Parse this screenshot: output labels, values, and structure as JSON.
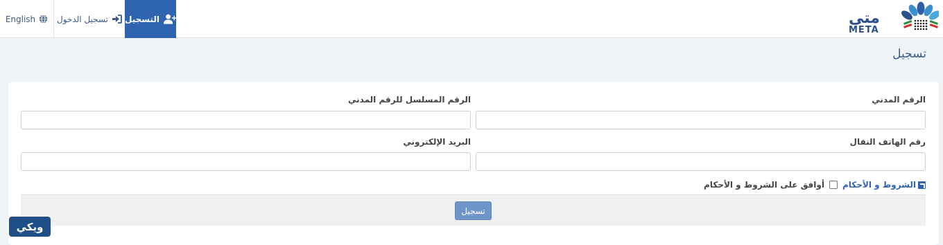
{
  "nav": {
    "english_label": "English",
    "login_label": "تسجيل الدخول",
    "register_label": "التسجيل"
  },
  "logo": {
    "arabic_text": "متى",
    "latin_text": "META"
  },
  "page_title": "تسجيل",
  "form": {
    "civil_id_label": "الرقم المدني",
    "civil_id_serial_label": "الرقم المسلسل للرقم المدني",
    "mobile_label": "رقم الهاتف النقال",
    "email_label": "البريد الإلكتروني",
    "civil_id_value": "",
    "civil_id_serial_value": "",
    "mobile_value": "",
    "email_value": ""
  },
  "terms": {
    "link_label": "الشروط و الأحكام",
    "agree_label": "أوافق على الشروط و الأحكام",
    "checked": false
  },
  "submit_label": "تسجيل",
  "watermark_text": "ويكي",
  "colors": {
    "primary": "#2f64b1",
    "title": "#3b5b86",
    "button": "#6f95c8",
    "background": "#eef3f8"
  }
}
